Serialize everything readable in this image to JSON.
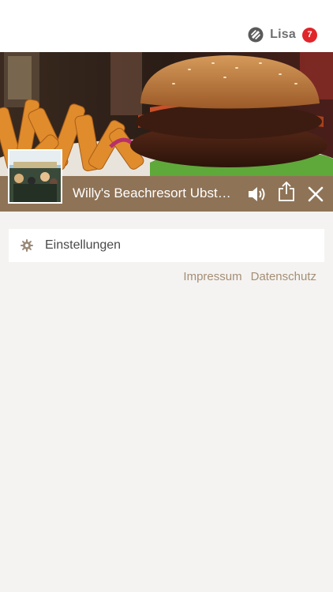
{
  "header": {
    "user_name": "Lisa",
    "notification_count": "7",
    "logo_icon": "app-logo-icon"
  },
  "player": {
    "station_title": "Willy's Beachresort Ubstadt-Weiher",
    "accent_color": "#8f7356",
    "icons": [
      "volume-icon",
      "share-icon",
      "close-icon"
    ]
  },
  "menu": {
    "settings_label": "Einstellungen",
    "settings_icon": "gear-icon"
  },
  "footer": {
    "impressum_label": "Impressum",
    "datenschutz_label": "Datenschutz"
  }
}
